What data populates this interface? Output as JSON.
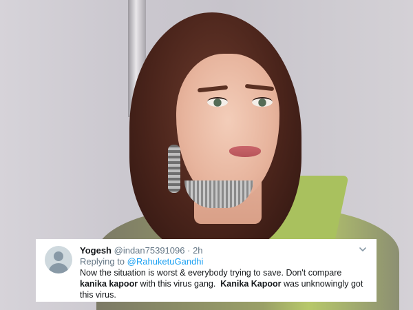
{
  "tweet": {
    "name": "Yogesh",
    "handle": "@indan75391096",
    "separator": "·",
    "time": "2h",
    "replying_to_label": "Replying to ",
    "replying_to_handle": "@RahuketuGandhi",
    "text": {
      "p1": "Now the situation is worst & everybody trying to save. Don't compare ",
      "b1": "kanika kapoor",
      "p2": " with this virus gang.  ",
      "b2": "Kanika Kapoor",
      "p3": " was unknowingly got this virus."
    },
    "icons": {
      "avatar": "default-avatar-icon",
      "menu": "chevron-down-icon"
    }
  },
  "colors": {
    "mention": "#1da1f2",
    "secondary_text": "#657786",
    "primary_text": "#14171a"
  }
}
